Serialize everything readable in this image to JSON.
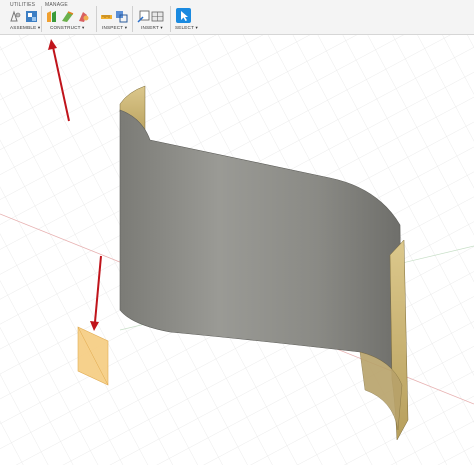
{
  "toolbar": {
    "tabs": {
      "utilities": "UTILITIES",
      "manage": "MANAGE"
    },
    "groups": {
      "assemble": "ASSEMBLE ▾",
      "construct": "CONSTRUCT ▾",
      "inspect": "INSPECT ▾",
      "insert": "INSERT ▾",
      "select": "SELECT ▾"
    }
  },
  "colors": {
    "surface_gray": "#8f8f89",
    "surface_edge": "#c8b272",
    "sketch_plane": "#f6cf86",
    "arrow": "#c0141b",
    "select_accent": "#1a8ae0"
  }
}
